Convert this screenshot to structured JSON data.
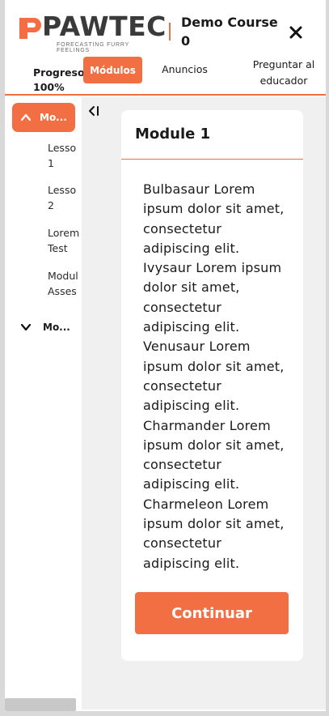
{
  "brand": {
    "name": "PAWTEC",
    "tagline": "FORECASTING FURRY FEELINGS",
    "accent": "#f26f43"
  },
  "course": {
    "title": "Demo Course 0"
  },
  "tabs": {
    "progress_label": "Progreso 100%",
    "progress_value": 100,
    "modulos": "Módulos",
    "anuncios": "Anuncios",
    "preguntar": "Preguntar al educador"
  },
  "sidebar": {
    "active_module": "Mo...",
    "lessons": [
      "Lesso\n1",
      "Lesso\n2",
      "Lorem\nTest",
      "Modul\nAsses"
    ],
    "collapsed_module": "Mo..."
  },
  "main": {
    "toggle_glyph": "<I",
    "card_title": "Module 1",
    "card_body": "Bulbasaur Lorem ipsum dolor sit amet, consectetur adipiscing elit. Ivysaur Lorem ipsum dolor sit amet, consectetur adipiscing elit. Venusaur Lorem ipsum dolor sit amet, consectetur adipiscing elit. Charmander Lorem ipsum dolor sit amet, consectetur adipiscing elit. Charmeleon Lorem ipsum dolor sit amet, consectetur adipiscing elit.",
    "continue_label": "Continuar"
  },
  "icons": {
    "close": "close-icon",
    "chevron_up": "chevron-up-icon",
    "chevron_down": "chevron-down-icon",
    "collapse": "collapse-sidebar-icon"
  }
}
